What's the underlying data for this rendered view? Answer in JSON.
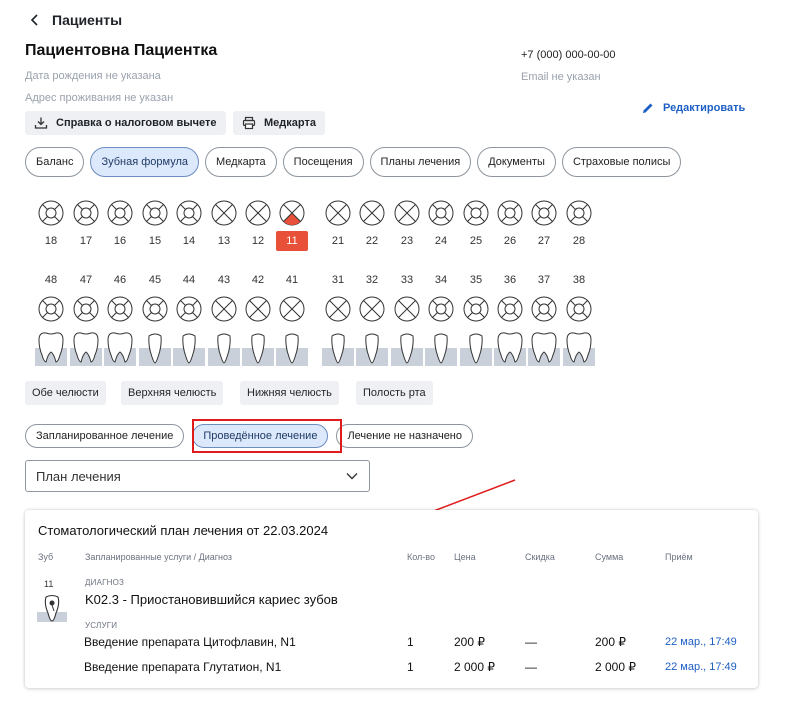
{
  "header": {
    "back_label": "Пациенты"
  },
  "patient": {
    "name": "Пациентовна Пациентка",
    "birth": "Дата рождения не указана",
    "address": "Адрес проживания не указан",
    "phone": "+7 (000) 000-00-00",
    "email": "Email не указан",
    "edit_label": "Редактировать"
  },
  "actions": {
    "tax_label": "Справка о налоговом вычете",
    "medcard_label": "Медкарта"
  },
  "tabs": [
    {
      "label": "Баланс"
    },
    {
      "label": "Зубная формула",
      "active": true
    },
    {
      "label": "Медкарта"
    },
    {
      "label": "Посещения"
    },
    {
      "label": "Планы лечения"
    },
    {
      "label": "Документы"
    },
    {
      "label": "Страховые полисы"
    }
  ],
  "teeth": {
    "upper": [
      "18",
      "17",
      "16",
      "15",
      "14",
      "13",
      "12",
      "11",
      "21",
      "22",
      "23",
      "24",
      "25",
      "26",
      "27",
      "28"
    ],
    "lower": [
      "48",
      "47",
      "46",
      "45",
      "44",
      "43",
      "42",
      "41",
      "31",
      "32",
      "33",
      "34",
      "35",
      "36",
      "37",
      "38"
    ],
    "selected": "11"
  },
  "jaw_buttons": [
    "Обе челюсти",
    "Верхняя челюсть",
    "Нижняя челюсть",
    "Полость рта"
  ],
  "status_tabs": [
    {
      "label": "Запланированное лечение"
    },
    {
      "label": "Проведённое лечение",
      "active": true
    },
    {
      "label": "Лечение не назначено"
    }
  ],
  "plan_select": {
    "value": "План лечения"
  },
  "plan": {
    "title": "Стоматологический план лечения от 22.03.2024",
    "columns": {
      "tooth": "Зуб",
      "services": "Запланированные услуги / Диагноз",
      "qty": "Кол-во",
      "price": "Цена",
      "discount": "Скидка",
      "sum": "Сумма",
      "visit": "Приём"
    },
    "tooth": "11",
    "diagnosis_label": "ДИАГНОЗ",
    "diagnosis": "K02.3 - Приостановившийся кариес зубов",
    "services_label": "УСЛУГИ",
    "services": [
      {
        "name": "Введение препарата Цитофлавин, N1",
        "qty": "1",
        "price": "200 ₽",
        "discount": "—",
        "sum": "200 ₽",
        "visit": "22 мар., 17:49"
      },
      {
        "name": "Введение препарата Глутатион, N1",
        "qty": "1",
        "price": "2 000 ₽",
        "discount": "—",
        "sum": "2 000 ₽",
        "visit": "22 мар., 17:49"
      }
    ]
  },
  "colors": {
    "accent": "#1d5fc4",
    "selected_tooth": "#e8503a",
    "active_tab_bg": "#dce8fb",
    "highlight": "#e01b1b"
  }
}
